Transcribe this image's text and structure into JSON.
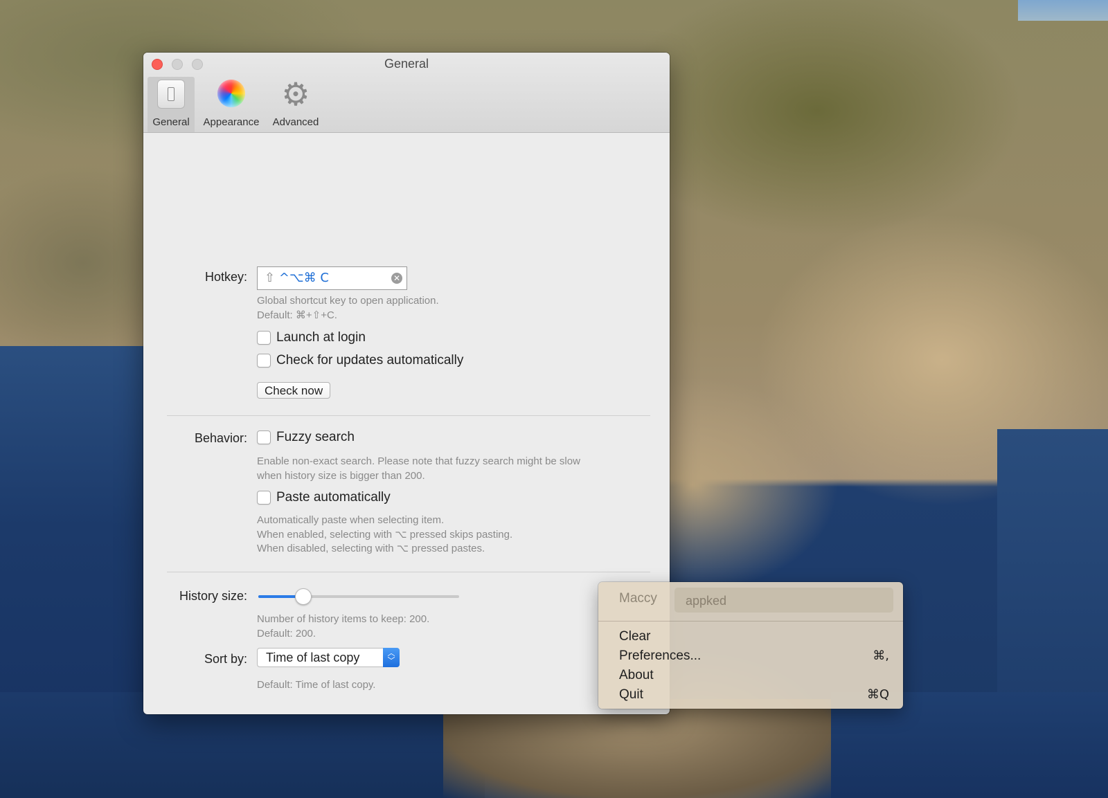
{
  "window": {
    "title": "General",
    "tabs": [
      {
        "label": "General",
        "icon": "switch-icon",
        "selected": true
      },
      {
        "label": "Appearance",
        "icon": "color-wheel-icon"
      },
      {
        "label": "Advanced",
        "icon": "gear-icon"
      }
    ]
  },
  "hotkey": {
    "label": "Hotkey:",
    "value_shift": "⇧",
    "value_rest": "^⌥⌘ C",
    "hint_line1": "Global shortcut key to open application.",
    "hint_line2": "Default: ⌘+⇧+C."
  },
  "launch_at_login": {
    "label": "Launch at login",
    "checked": false
  },
  "check_updates": {
    "label": "Check for updates automatically",
    "checked": false
  },
  "check_now_button": "Check now",
  "behavior": {
    "label": "Behavior:",
    "fuzzy_search": {
      "label": "Fuzzy search",
      "checked": false
    },
    "fuzzy_hint_line1": "Enable non-exact search. Please note that fuzzy search might be slow",
    "fuzzy_hint_line2": "when history size is bigger than 200.",
    "paste_automatically": {
      "label": "Paste automatically",
      "checked": false
    },
    "paste_hint_line1": "Automatically paste when selecting item.",
    "paste_hint_line2": "When enabled, selecting with ⌥ pressed skips pasting.",
    "paste_hint_line3": "When disabled, selecting with ⌥ pressed pastes."
  },
  "history_size": {
    "label": "History size:",
    "value_fraction": 0.22,
    "hint_line1": "Number of history items to keep: 200.",
    "hint_line2": "Default: 200."
  },
  "sort_by": {
    "label": "Sort by:",
    "selected": "Time of last copy",
    "hint": "Default: Time of last copy."
  },
  "menu": {
    "app_name": "Maccy",
    "search_value": "appked",
    "items": [
      {
        "label": "Clear",
        "shortcut": ""
      },
      {
        "label": "Preferences...",
        "shortcut": "⌘,"
      },
      {
        "label": "About",
        "shortcut": ""
      },
      {
        "label": "Quit",
        "shortcut": "⌘Q"
      }
    ]
  },
  "colors": {
    "accent": "#2b7be7",
    "close_button": "#fc5f57"
  }
}
